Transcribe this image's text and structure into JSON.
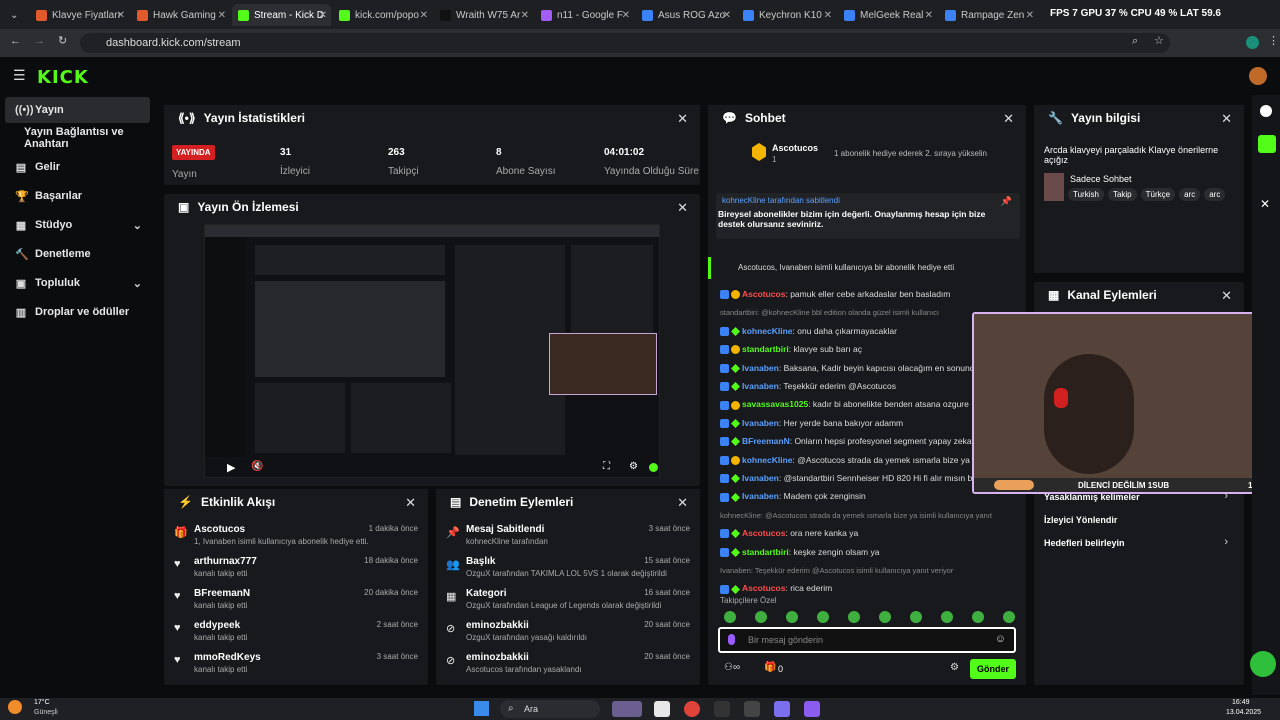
{
  "browser": {
    "tabs": [
      "Klavye Fiyatları",
      "Hawk Gaming",
      "Stream - Kick D",
      "kick.com/popo",
      "Wraith W75 Ar",
      "n11 - Google F",
      "Asus ROG Azo",
      "Keychron K10",
      "MelGeek Real",
      "Rampage Zen"
    ],
    "overlay": "FPS 7  GPU 37 %  CPU 49 %  LAT 59.6",
    "url": "dashboard.kick.com/stream"
  },
  "sidebar": {
    "items": [
      "Yayın",
      "Yayın Bağlantısı ve Anahtarı",
      "Gelir",
      "Başarılar",
      "Stüdyo",
      "Denetleme",
      "Topluluk",
      "Droplar ve ödüller"
    ]
  },
  "stats": {
    "title": "Yayın İstatistikleri",
    "live": "YAYINDA",
    "live_label": "Yayın",
    "items": [
      {
        "v": "31",
        "l": "İzleyici"
      },
      {
        "v": "263",
        "l": "Takipçi"
      },
      {
        "v": "8",
        "l": "Abone Sayısı"
      },
      {
        "v": "04:01:02",
        "l": "Yayında Olduğu Süre"
      }
    ]
  },
  "preview": {
    "title": "Yayın Ön İzlemesi"
  },
  "activity": {
    "title": "Etkinlik Akışı",
    "items": [
      {
        "name": "Ascotucos",
        "sub": "1, Ivanaben isimli kullanıcıya abonelik hediye etti.",
        "time": "1 dakika önce"
      },
      {
        "name": "arthurnax777",
        "sub": "kanalı takip etti",
        "time": "18 dakika önce"
      },
      {
        "name": "BFreemanN",
        "sub": "kanalı takip etti",
        "time": "20 dakika önce"
      },
      {
        "name": "eddypeek",
        "sub": "kanalı takip etti",
        "time": "2 saat önce"
      },
      {
        "name": "mmoRedKeys",
        "sub": "kanalı takip etti",
        "time": "3 saat önce"
      }
    ]
  },
  "moderation": {
    "title": "Denetim Eylemleri",
    "items": [
      {
        "name": "Mesaj Sabitlendi",
        "sub": "kohnecKline tarafından",
        "time": "3 saat önce"
      },
      {
        "name": "Başlık",
        "sub": "OzguX tarafından TAKIMLA LOL 5VS 1 olarak değiştirildi",
        "time": "15 saat önce"
      },
      {
        "name": "Kategori",
        "sub": "OzguX tarafından League of Legends olarak değiştirildi",
        "time": "16 saat önce"
      },
      {
        "name": "eminozbakkii",
        "sub": "OzguX tarafından yasağı kaldırıldı",
        "time": "20 saat önce"
      },
      {
        "name": "eminozbakkii",
        "sub": "Ascotucos tarafından yasaklandı",
        "time": "20 saat önce"
      }
    ]
  },
  "chat": {
    "title": "Sohbet",
    "top_user": "Ascotucos",
    "top_count": "1",
    "top_msg": "1 abonelik hediye ederek 2. sıraya yükselin",
    "pinned_by": "kohnecKline tarafından sabitlendi",
    "pinned": "Bireysel abonelikler bizim için değerli. Onaylanmış hesap için bize destek olursanız seviniriz.",
    "gift": "Ascotucos, Ivanaben isimli kullanıcıya bir abonelik hediye etti",
    "messages": [
      {
        "u": "Ascotucos",
        "c": "#ff4d4d",
        "t": ": pamuk eller cebe arkadaslar ben basladım"
      },
      {
        "u": "",
        "c": "#888",
        "t": "standartbiri: @kohnecKline bbl edition olanda güzel isimli kullanıcı"
      },
      {
        "u": "kohnecKline",
        "c": "#5aa0ff",
        "t": ": onu daha çıkarmayacaklar"
      },
      {
        "u": "standartbiri",
        "c": "#53fc18",
        "t": ": klavye sub barı aç"
      },
      {
        "u": "Ivanaben",
        "c": "#5aa0ff",
        "t": ": Baksana, Kadir beyin kapıcısı olacağım en sonunda"
      },
      {
        "u": "Ivanaben",
        "c": "#5aa0ff",
        "t": ": Teşekkür ederim @Ascotucos"
      },
      {
        "u": "savassavas1025",
        "c": "#53fc18",
        "t": ": kadır bi abonelikte benden atsana ozgure"
      },
      {
        "u": "Ivanaben",
        "c": "#5aa0ff",
        "t": ": Her yerde bana bakıyor adamm"
      },
      {
        "u": "BFreemanN",
        "c": "#5aa0ff",
        "t": ": Onların hepsi profesyonel segment yapay zekaya göre detaylı araştırabilirim"
      },
      {
        "u": "kohnecKline",
        "c": "#5aa0ff",
        "t": ": @Ascotucos strada da yemek ısmarla bize ya"
      },
      {
        "u": "Ivanaben",
        "c": "#5aa0ff",
        "t": ": @standartbiri Sennheiser HD 820 Hi fi alır mısın bana da bi"
      },
      {
        "u": "Ivanaben",
        "c": "#5aa0ff",
        "t": ": Madem çok zenginsin"
      },
      {
        "u": "",
        "c": "#888",
        "t": "kohnecKline: @Ascotucos strada da yemek ısmarla bize ya isimli kullanıcıya yanıt"
      },
      {
        "u": "Ascotucos",
        "c": "#ff4d4d",
        "t": ": ora nere kanka ya"
      },
      {
        "u": "standartbiri",
        "c": "#53fc18",
        "t": ": keşke zengin olsam ya"
      },
      {
        "u": "",
        "c": "#888",
        "t": "Ivanaben: Teşekkür ederim @Ascotucos isimli kullanıcıya yanıt veriyor"
      },
      {
        "u": "Ascotucos",
        "c": "#ff4d4d",
        "t": ": rica ederim"
      }
    ],
    "followers_only": "Takipçilere Özel",
    "placeholder": "Bir mesaj gönderin",
    "send": "Gönder",
    "count": "0"
  },
  "info": {
    "title": "Yayın bilgisi",
    "stream_title": "Arcda klavyeyi parçaladık Klavye önerilerne açığız",
    "mode": "Sadece Sohbet",
    "tags": [
      "Turkish",
      "Takip",
      "Türkçe",
      "arc",
      "arc"
    ]
  },
  "channel": {
    "title": "Kanal Eylemleri",
    "webcam_caption": "DİLENCİ DEĞİLİM 1SUB",
    "webcam_count": "10",
    "items": [
      "Yasaklanmış kelimeler",
      "İzleyici Yönlendir",
      "Hedefleri belirleyin"
    ]
  },
  "taskbar": {
    "weather": "17°C",
    "weather_sub": "Güneşli",
    "search": "Ara",
    "time": "16:49",
    "date": "13.04.2025"
  },
  "colors": {
    "accent": "#53fc18",
    "panel": "#18191c",
    "bg": "#0b0c0e",
    "live": "#d42020"
  }
}
